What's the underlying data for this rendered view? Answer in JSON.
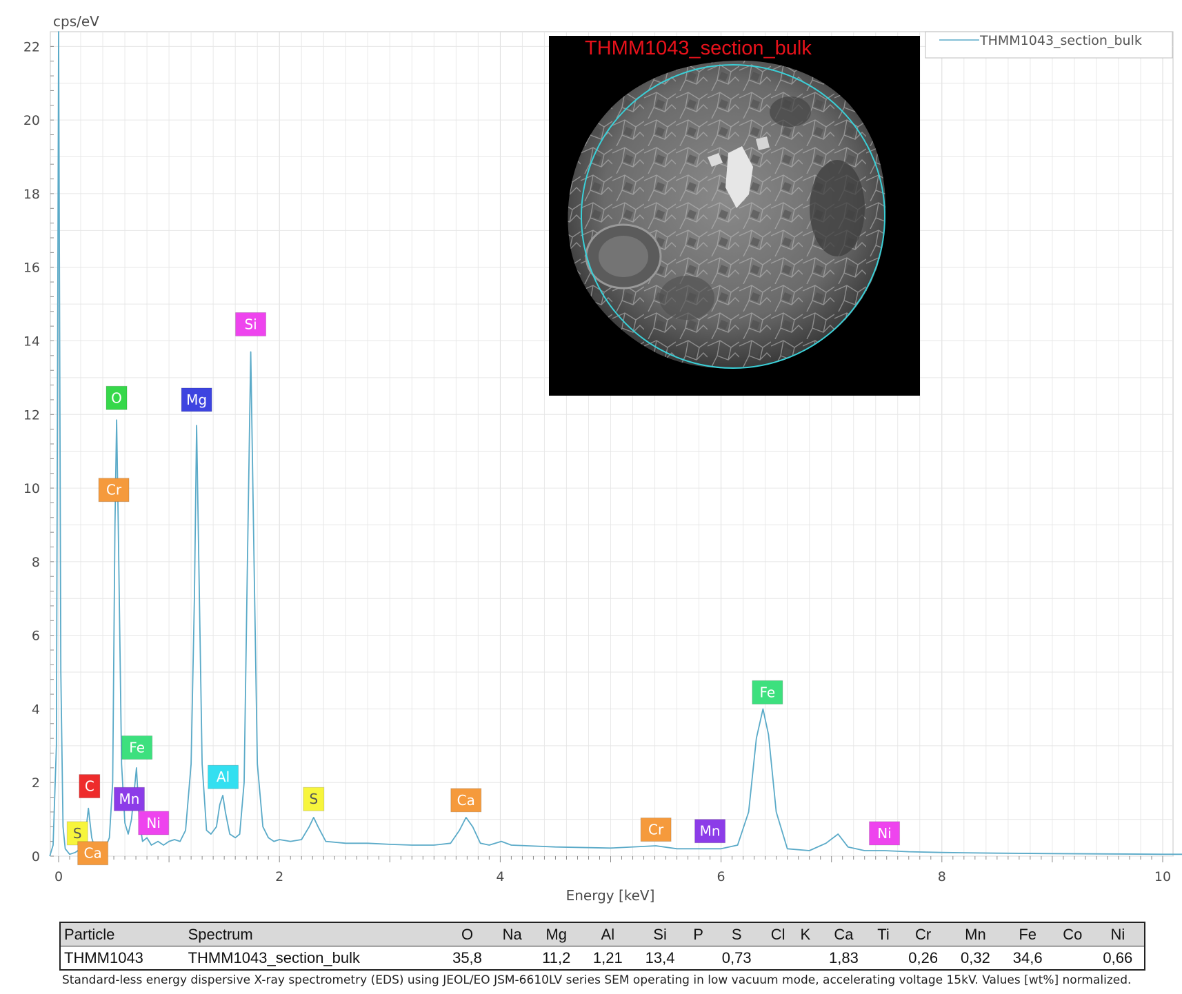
{
  "chart_data": {
    "type": "line",
    "ylabel": "cps/eV",
    "xlabel": "Energy [keV]",
    "xlim": [
      0,
      10.2
    ],
    "ylim": [
      0,
      22.4
    ],
    "xticks": [
      "0",
      "2",
      "4",
      "6",
      "8",
      "10"
    ],
    "yticks": [
      "0",
      "2",
      "4",
      "6",
      "8",
      "10",
      "12",
      "14",
      "16",
      "18",
      "20",
      "22"
    ],
    "grid": true,
    "legend_position": "top-right",
    "series": [
      {
        "name": "THMM1043_section_bulk",
        "color": "#5aaac8",
        "points": [
          [
            -0.08,
            0
          ],
          [
            -0.05,
            0.3
          ],
          [
            -0.02,
            3
          ],
          [
            0.0,
            22.4
          ],
          [
            0.02,
            5
          ],
          [
            0.04,
            0.8
          ],
          [
            0.06,
            0.2
          ],
          [
            0.1,
            0.05
          ],
          [
            0.15,
            0.1
          ],
          [
            0.2,
            0.2
          ],
          [
            0.24,
            0.5
          ],
          [
            0.27,
            1.3
          ],
          [
            0.3,
            0.5
          ],
          [
            0.34,
            0.1
          ],
          [
            0.38,
            0.12
          ],
          [
            0.42,
            0.2
          ],
          [
            0.46,
            0.5
          ],
          [
            0.49,
            2.0
          ],
          [
            0.51,
            9.0
          ],
          [
            0.525,
            11.85
          ],
          [
            0.54,
            9.0
          ],
          [
            0.57,
            2.5
          ],
          [
            0.6,
            0.9
          ],
          [
            0.63,
            0.6
          ],
          [
            0.66,
            1.0
          ],
          [
            0.705,
            2.4
          ],
          [
            0.73,
            1.0
          ],
          [
            0.76,
            0.4
          ],
          [
            0.8,
            0.5
          ],
          [
            0.84,
            0.3
          ],
          [
            0.9,
            0.4
          ],
          [
            0.95,
            0.3
          ],
          [
            1.0,
            0.4
          ],
          [
            1.05,
            0.45
          ],
          [
            1.1,
            0.4
          ],
          [
            1.15,
            0.7
          ],
          [
            1.2,
            2.5
          ],
          [
            1.23,
            7.0
          ],
          [
            1.25,
            11.7
          ],
          [
            1.27,
            8.0
          ],
          [
            1.3,
            2.5
          ],
          [
            1.34,
            0.7
          ],
          [
            1.38,
            0.6
          ],
          [
            1.43,
            0.8
          ],
          [
            1.46,
            1.4
          ],
          [
            1.487,
            1.65
          ],
          [
            1.51,
            1.2
          ],
          [
            1.55,
            0.6
          ],
          [
            1.6,
            0.5
          ],
          [
            1.64,
            0.6
          ],
          [
            1.68,
            2.0
          ],
          [
            1.71,
            8.0
          ],
          [
            1.74,
            13.7
          ],
          [
            1.77,
            8.0
          ],
          [
            1.8,
            2.5
          ],
          [
            1.85,
            0.8
          ],
          [
            1.9,
            0.5
          ],
          [
            1.95,
            0.4
          ],
          [
            2.0,
            0.45
          ],
          [
            2.1,
            0.4
          ],
          [
            2.2,
            0.45
          ],
          [
            2.27,
            0.8
          ],
          [
            2.31,
            1.05
          ],
          [
            2.35,
            0.8
          ],
          [
            2.42,
            0.4
          ],
          [
            2.6,
            0.35
          ],
          [
            2.8,
            0.35
          ],
          [
            3.0,
            0.32
          ],
          [
            3.2,
            0.3
          ],
          [
            3.4,
            0.3
          ],
          [
            3.55,
            0.35
          ],
          [
            3.63,
            0.7
          ],
          [
            3.69,
            1.05
          ],
          [
            3.75,
            0.8
          ],
          [
            3.82,
            0.35
          ],
          [
            3.9,
            0.3
          ],
          [
            4.01,
            0.4
          ],
          [
            4.1,
            0.3
          ],
          [
            4.5,
            0.25
          ],
          [
            5.0,
            0.22
          ],
          [
            5.41,
            0.28
          ],
          [
            5.6,
            0.2
          ],
          [
            5.9,
            0.2
          ],
          [
            6.0,
            0.2
          ],
          [
            6.15,
            0.3
          ],
          [
            6.25,
            1.2
          ],
          [
            6.32,
            3.2
          ],
          [
            6.38,
            4.0
          ],
          [
            6.43,
            3.3
          ],
          [
            6.5,
            1.2
          ],
          [
            6.6,
            0.2
          ],
          [
            6.8,
            0.15
          ],
          [
            6.95,
            0.35
          ],
          [
            7.06,
            0.6
          ],
          [
            7.15,
            0.25
          ],
          [
            7.3,
            0.15
          ],
          [
            7.48,
            0.15
          ],
          [
            7.7,
            0.12
          ],
          [
            8.0,
            0.1
          ],
          [
            8.5,
            0.08
          ],
          [
            9.0,
            0.07
          ],
          [
            9.5,
            0.06
          ],
          [
            10.0,
            0.05
          ],
          [
            10.2,
            0.05
          ]
        ]
      }
    ],
    "peak_labels": [
      {
        "text": "Si",
        "energy": 1.74,
        "value": 14.45,
        "bg": "#ee44ee",
        "fg": "#ffffff"
      },
      {
        "text": "O",
        "energy": 0.525,
        "value": 12.45,
        "bg": "#36d84a",
        "fg": "#ffffff"
      },
      {
        "text": "Mg",
        "energy": 1.25,
        "value": 12.4,
        "bg": "#3d44e0",
        "fg": "#ffffff"
      },
      {
        "text": "Cr",
        "energy": 0.5,
        "value": 9.95,
        "bg": "#f59a3c",
        "fg": "#ffffff"
      },
      {
        "text": "Fe",
        "energy": 6.42,
        "value": 4.45,
        "bg": "#3de07e",
        "fg": "#ffffff"
      },
      {
        "text": "Fe",
        "energy": 0.71,
        "value": 2.95,
        "bg": "#3de07e",
        "fg": "#ffffff"
      },
      {
        "text": "Al",
        "energy": 1.49,
        "value": 2.15,
        "bg": "#33dff0",
        "fg": "#ffffff"
      },
      {
        "text": "C",
        "energy": 0.28,
        "value": 1.9,
        "bg": "#ee2c2c",
        "fg": "#ffffff"
      },
      {
        "text": "Mn",
        "energy": 0.64,
        "value": 1.55,
        "bg": "#8c3ce8",
        "fg": "#ffffff"
      },
      {
        "text": "S",
        "energy": 2.31,
        "value": 1.55,
        "bg": "#f7f53c",
        "fg": "#555555"
      },
      {
        "text": "Ca",
        "energy": 3.69,
        "value": 1.52,
        "bg": "#f59a3c",
        "fg": "#ffffff"
      },
      {
        "text": "Ni",
        "energy": 0.86,
        "value": 0.9,
        "bg": "#ee44ee",
        "fg": "#ffffff"
      },
      {
        "text": "Cr",
        "energy": 5.41,
        "value": 0.72,
        "bg": "#f59a3c",
        "fg": "#ffffff"
      },
      {
        "text": "Mn",
        "energy": 5.9,
        "value": 0.68,
        "bg": "#8c3ce8",
        "fg": "#ffffff"
      },
      {
        "text": "Ni",
        "energy": 7.48,
        "value": 0.62,
        "bg": "#ee44ee",
        "fg": "#ffffff"
      },
      {
        "text": "S",
        "energy": 0.17,
        "value": 0.62,
        "bg": "#f7f53c",
        "fg": "#555555"
      },
      {
        "text": "Ca",
        "energy": 0.31,
        "value": 0.08,
        "bg": "#f59a3c",
        "fg": "#ffffff"
      }
    ]
  },
  "inset": {
    "title": "THMM1043_section_bulk",
    "title_color": "#e8121b",
    "circle_color": "#3ad0d8"
  },
  "table": {
    "headers": [
      "Particle",
      "Spectrum",
      "O",
      "Na",
      "Mg",
      "Al",
      "Si",
      "P",
      "S",
      "Cl",
      "K",
      "Ca",
      "Ti",
      "Cr",
      "Mn",
      "Fe",
      "Co",
      "Ni"
    ],
    "rows": [
      [
        "THMM1043",
        "THMM1043_section_bulk",
        "35,8",
        "",
        "11,2",
        "1,21",
        "13,4",
        "",
        "0,73",
        "",
        "",
        "1,83",
        "",
        "0,26",
        "0,32",
        "34,6",
        "",
        "0,66"
      ]
    ]
  },
  "footnote": "Standard-less energy dispersive X-ray spectrometry (EDS) using JEOL/EO JSM-6610LV series SEM operating in low vacuum mode, accelerating voltage 15kV. Values [wt%] normalized."
}
